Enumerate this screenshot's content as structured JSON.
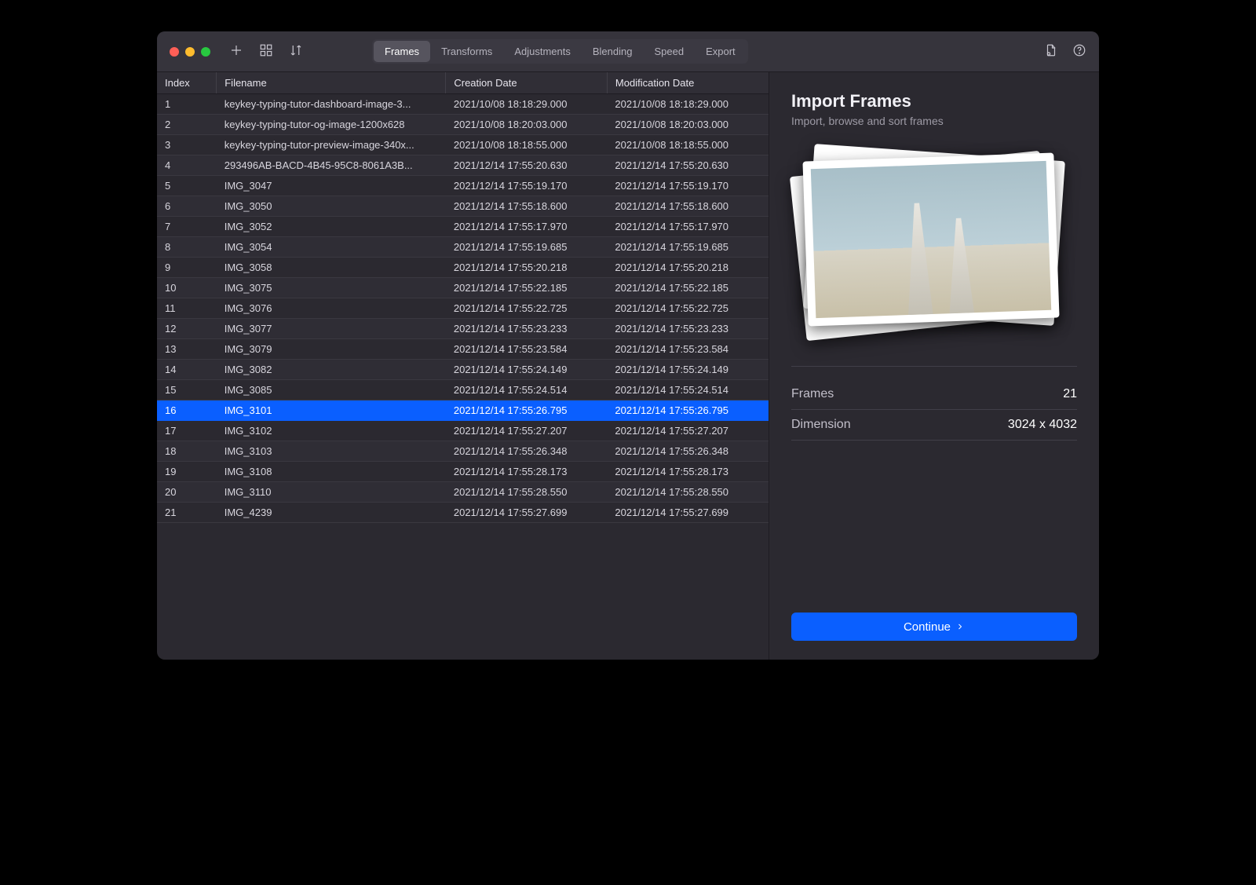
{
  "tabs": {
    "frames": "Frames",
    "transforms": "Transforms",
    "adjustments": "Adjustments",
    "blending": "Blending",
    "speed": "Speed",
    "export": "Export"
  },
  "table": {
    "headers": {
      "index": "Index",
      "filename": "Filename",
      "creation": "Creation Date",
      "modification": "Modification Date"
    },
    "rows": [
      {
        "index": "1",
        "filename": "keykey-typing-tutor-dashboard-image-3...",
        "creation": "2021/10/08 18:18:29.000",
        "modification": "2021/10/08 18:18:29.000"
      },
      {
        "index": "2",
        "filename": "keykey-typing-tutor-og-image-1200x628",
        "creation": "2021/10/08 18:20:03.000",
        "modification": "2021/10/08 18:20:03.000"
      },
      {
        "index": "3",
        "filename": "keykey-typing-tutor-preview-image-340x...",
        "creation": "2021/10/08 18:18:55.000",
        "modification": "2021/10/08 18:18:55.000"
      },
      {
        "index": "4",
        "filename": "293496AB-BACD-4B45-95C8-8061A3B...",
        "creation": "2021/12/14 17:55:20.630",
        "modification": "2021/12/14 17:55:20.630"
      },
      {
        "index": "5",
        "filename": "IMG_3047",
        "creation": "2021/12/14 17:55:19.170",
        "modification": "2021/12/14 17:55:19.170"
      },
      {
        "index": "6",
        "filename": "IMG_3050",
        "creation": "2021/12/14 17:55:18.600",
        "modification": "2021/12/14 17:55:18.600"
      },
      {
        "index": "7",
        "filename": "IMG_3052",
        "creation": "2021/12/14 17:55:17.970",
        "modification": "2021/12/14 17:55:17.970"
      },
      {
        "index": "8",
        "filename": "IMG_3054",
        "creation": "2021/12/14 17:55:19.685",
        "modification": "2021/12/14 17:55:19.685"
      },
      {
        "index": "9",
        "filename": "IMG_3058",
        "creation": "2021/12/14 17:55:20.218",
        "modification": "2021/12/14 17:55:20.218"
      },
      {
        "index": "10",
        "filename": "IMG_3075",
        "creation": "2021/12/14 17:55:22.185",
        "modification": "2021/12/14 17:55:22.185"
      },
      {
        "index": "11",
        "filename": "IMG_3076",
        "creation": "2021/12/14 17:55:22.725",
        "modification": "2021/12/14 17:55:22.725"
      },
      {
        "index": "12",
        "filename": "IMG_3077",
        "creation": "2021/12/14 17:55:23.233",
        "modification": "2021/12/14 17:55:23.233"
      },
      {
        "index": "13",
        "filename": "IMG_3079",
        "creation": "2021/12/14 17:55:23.584",
        "modification": "2021/12/14 17:55:23.584"
      },
      {
        "index": "14",
        "filename": "IMG_3082",
        "creation": "2021/12/14 17:55:24.149",
        "modification": "2021/12/14 17:55:24.149"
      },
      {
        "index": "15",
        "filename": "IMG_3085",
        "creation": "2021/12/14 17:55:24.514",
        "modification": "2021/12/14 17:55:24.514"
      },
      {
        "index": "16",
        "filename": "IMG_3101",
        "creation": "2021/12/14 17:55:26.795",
        "modification": "2021/12/14 17:55:26.795"
      },
      {
        "index": "17",
        "filename": "IMG_3102",
        "creation": "2021/12/14 17:55:27.207",
        "modification": "2021/12/14 17:55:27.207"
      },
      {
        "index": "18",
        "filename": "IMG_3103",
        "creation": "2021/12/14 17:55:26.348",
        "modification": "2021/12/14 17:55:26.348"
      },
      {
        "index": "19",
        "filename": "IMG_3108",
        "creation": "2021/12/14 17:55:28.173",
        "modification": "2021/12/14 17:55:28.173"
      },
      {
        "index": "20",
        "filename": "IMG_3110",
        "creation": "2021/12/14 17:55:28.550",
        "modification": "2021/12/14 17:55:28.550"
      },
      {
        "index": "21",
        "filename": "IMG_4239",
        "creation": "2021/12/14 17:55:27.699",
        "modification": "2021/12/14 17:55:27.699"
      }
    ],
    "selected_index": 15
  },
  "inspector": {
    "title": "Import Frames",
    "subtitle": "Import, browse and sort frames",
    "frames_label": "Frames",
    "frames_value": "21",
    "dimension_label": "Dimension",
    "dimension_value": "3024 x 4032",
    "continue_label": "Continue"
  }
}
